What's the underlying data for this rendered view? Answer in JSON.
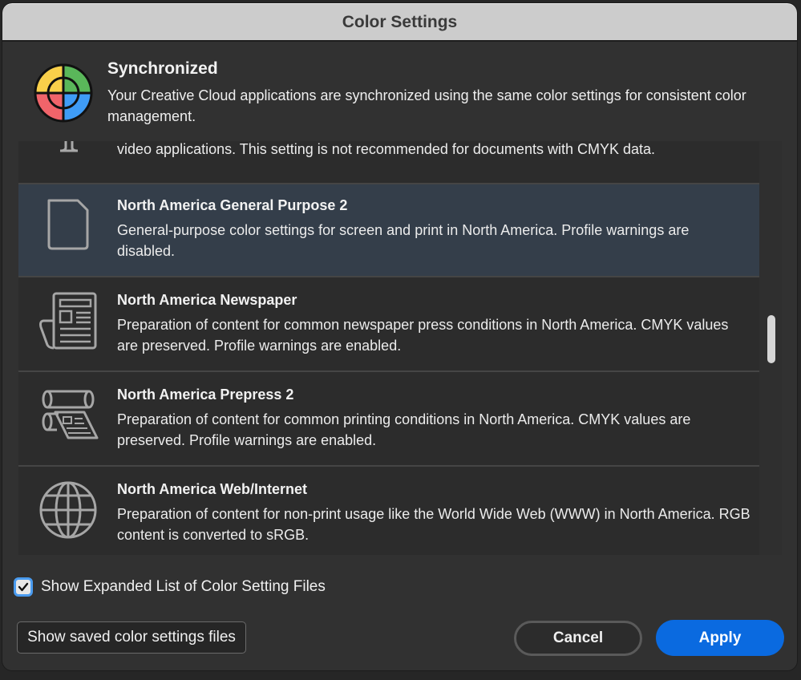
{
  "window": {
    "title": "Color Settings"
  },
  "sync": {
    "title": "Synchronized",
    "description": "Your Creative Cloud applications are synchronized using the same color settings for consistent color management."
  },
  "list": {
    "partial_item": {
      "icon": "video-monitor-icon",
      "description": "video applications. This setting is not recommended for documents with CMYK data."
    },
    "items": [
      {
        "icon": "document-icon",
        "name": "North America General Purpose 2",
        "description": "General-purpose color settings for screen and print in North America. Profile warnings are disabled.",
        "selected": true
      },
      {
        "icon": "newspaper-icon",
        "name": "North America Newspaper",
        "description": "Preparation of content for common newspaper press conditions in North America. CMYK values are preserved. Profile warnings are enabled.",
        "selected": false
      },
      {
        "icon": "printing-press-icon",
        "name": "North America Prepress 2",
        "description": "Preparation of content for common printing conditions in North America. CMYK values are preserved. Profile warnings are enabled.",
        "selected": false
      },
      {
        "icon": "globe-icon",
        "name": "North America Web/Internet",
        "description": "Preparation of content for non-print usage like the World Wide Web (WWW) in North America. RGB content is converted to sRGB.",
        "selected": false
      }
    ]
  },
  "options": {
    "expanded_list_label": "Show Expanded List of Color Setting Files",
    "expanded_list_checked": true
  },
  "buttons": {
    "show_saved": "Show saved color settings files",
    "cancel": "Cancel",
    "apply": "Apply"
  },
  "colors": {
    "accent": "#0a6ae0",
    "selected_row": "#343e4a",
    "focus_ring": "#4a9bef"
  }
}
